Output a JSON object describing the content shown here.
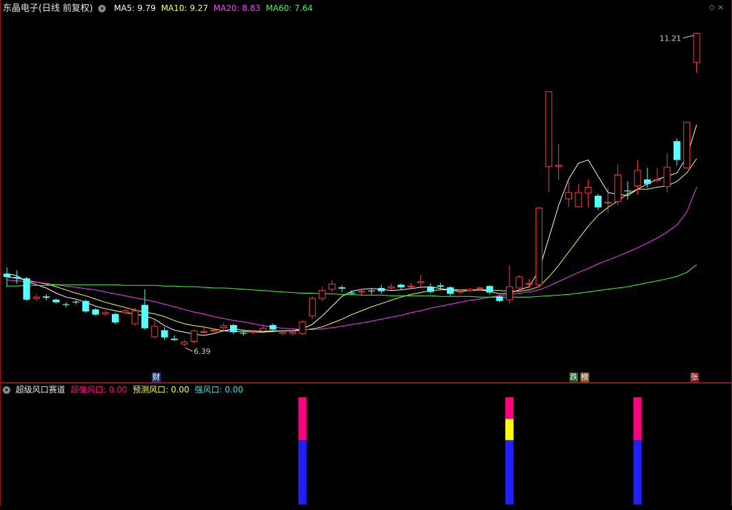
{
  "main_header": {
    "title": "东晶电子(日线 前复权)",
    "ma5_label": "MA5:",
    "ma5_value": "9.79",
    "ma10_label": "MA10:",
    "ma10_value": "9.27",
    "ma20_label": "MA20:",
    "ma20_value": "8.83",
    "ma60_label": "MA60:",
    "ma60_value": "7.64"
  },
  "sub_header": {
    "title": "超级风口赛道",
    "s1_label": "超强风口:",
    "s1_value": "0.00",
    "s2_label": "预测风口:",
    "s2_value": "0.00",
    "s3_label": "强风口:",
    "s3_value": "0.00"
  },
  "tags": {
    "cai": "财",
    "die": "跌",
    "bang": "榜",
    "zhang": "张"
  },
  "annotations": {
    "high_label": "11.21",
    "low_label": "6.39"
  },
  "colors": {
    "up": "#ff3c3c",
    "down": "#54ffff",
    "ma5": "#ffffff",
    "ma10": "#ffff3c",
    "ma20": "#ff3cff",
    "ma60": "#3cff3c",
    "bar_pink": "#ff0080",
    "bar_blue": "#2020ff",
    "bar_yellow": "#ffff00",
    "border": "#8b1a1a"
  },
  "chart_data": [
    {
      "type": "candlestick",
      "title": "东晶电子(日线 前复权)",
      "ylim": [
        6.0,
        11.5
      ],
      "candles": [
        [
          7.5,
          7.45,
          7.6,
          7.3
        ],
        [
          7.45,
          7.43,
          7.55,
          7.35
        ],
        [
          7.43,
          7.1,
          7.45,
          7.08
        ],
        [
          7.12,
          7.14,
          7.18,
          7.08
        ],
        [
          7.15,
          7.13,
          7.18,
          7.09
        ],
        [
          7.1,
          7.06,
          7.12,
          7.04
        ],
        [
          7.03,
          7.02,
          7.06,
          6.98
        ],
        [
          7.07,
          7.06,
          7.09,
          7.03
        ],
        [
          7.08,
          6.92,
          7.1,
          6.9
        ],
        [
          6.95,
          6.87,
          6.97,
          6.85
        ],
        [
          6.88,
          6.9,
          6.93,
          6.85
        ],
        [
          6.88,
          6.75,
          6.9,
          6.72
        ],
        [
          6.9,
          6.93,
          6.96,
          6.88
        ],
        [
          6.73,
          6.93,
          6.97,
          6.7
        ],
        [
          7.02,
          6.66,
          7.26,
          6.64
        ],
        [
          6.53,
          6.69,
          6.78,
          6.5
        ],
        [
          6.63,
          6.52,
          6.68,
          6.48
        ],
        [
          6.5,
          6.48,
          6.55,
          6.46
        ],
        [
          6.42,
          6.45,
          6.48,
          6.39
        ],
        [
          6.46,
          6.62,
          6.64,
          6.43
        ],
        [
          6.6,
          6.61,
          6.7,
          6.58
        ],
        [
          6.63,
          6.63,
          6.66,
          6.6
        ],
        [
          6.67,
          6.7,
          6.74,
          6.63
        ],
        [
          6.71,
          6.6,
          6.73,
          6.57
        ],
        [
          6.59,
          6.58,
          6.62,
          6.55
        ],
        [
          6.6,
          6.61,
          6.64,
          6.57
        ],
        [
          6.62,
          6.66,
          6.72,
          6.58
        ],
        [
          6.71,
          6.64,
          6.73,
          6.62
        ],
        [
          6.58,
          6.6,
          6.62,
          6.55
        ],
        [
          6.58,
          6.6,
          6.63,
          6.55
        ],
        [
          6.58,
          6.76,
          6.78,
          6.56
        ],
        [
          6.85,
          7.12,
          7.15,
          6.8
        ],
        [
          7.12,
          7.24,
          7.3,
          7.08
        ],
        [
          7.26,
          7.34,
          7.4,
          7.22
        ],
        [
          7.29,
          7.27,
          7.32,
          7.22
        ],
        [
          7.21,
          7.2,
          7.24,
          7.17
        ],
        [
          7.22,
          7.23,
          7.27,
          7.16
        ],
        [
          7.24,
          7.23,
          7.28,
          7.18
        ],
        [
          7.28,
          7.23,
          7.33,
          7.19
        ],
        [
          7.28,
          7.3,
          7.35,
          7.25
        ],
        [
          7.33,
          7.29,
          7.35,
          7.25
        ],
        [
          7.3,
          7.31,
          7.36,
          7.27
        ],
        [
          7.36,
          7.38,
          7.48,
          7.28
        ],
        [
          7.3,
          7.22,
          7.35,
          7.2
        ],
        [
          7.32,
          7.3,
          7.36,
          7.26
        ],
        [
          7.29,
          7.19,
          7.31,
          7.16
        ],
        [
          7.22,
          7.23,
          7.26,
          7.18
        ],
        [
          7.24,
          7.26,
          7.28,
          7.22
        ],
        [
          7.27,
          7.28,
          7.3,
          7.24
        ],
        [
          7.31,
          7.21,
          7.32,
          7.18
        ],
        [
          7.15,
          7.08,
          7.17,
          7.06
        ],
        [
          7.1,
          7.3,
          7.63,
          7.04
        ],
        [
          7.28,
          7.45,
          7.48,
          7.25
        ],
        [
          7.35,
          7.35,
          7.42,
          7.28
        ],
        [
          7.33,
          8.51,
          8.52,
          7.29
        ],
        [
          9.15,
          10.3,
          10.3,
          8.75
        ],
        [
          9.15,
          9.17,
          9.49,
          8.94
        ],
        [
          8.65,
          8.75,
          8.92,
          8.53
        ],
        [
          8.53,
          8.75,
          8.88,
          8.52
        ],
        [
          8.74,
          8.83,
          8.95,
          8.52
        ],
        [
          8.7,
          8.52,
          8.73,
          8.48
        ],
        [
          8.6,
          8.6,
          8.82,
          8.44
        ],
        [
          8.61,
          9.02,
          9.18,
          8.55
        ],
        [
          8.78,
          8.77,
          8.92,
          8.64
        ],
        [
          8.85,
          9.09,
          9.25,
          8.72
        ],
        [
          8.95,
          8.88,
          9.13,
          8.82
        ],
        [
          8.95,
          8.95,
          9.12,
          8.91
        ],
        [
          8.84,
          9.14,
          9.35,
          8.75
        ],
        [
          9.54,
          9.25,
          9.58,
          9.16
        ],
        [
          9.13,
          9.83,
          9.83,
          9.12
        ],
        [
          10.75,
          11.2,
          11.21,
          10.59
        ]
      ],
      "ma_series": [
        {
          "name": "MA5",
          "color": "#ffffff",
          "values": [
            7.5,
            7.47,
            7.38,
            7.33,
            7.28,
            7.2,
            7.14,
            7.11,
            7.06,
            7.0,
            6.96,
            6.93,
            6.9,
            6.88,
            6.85,
            6.8,
            6.7,
            6.63,
            6.6,
            6.57,
            6.55,
            6.58,
            6.62,
            6.65,
            6.63,
            6.62,
            6.61,
            6.62,
            6.62,
            6.62,
            6.65,
            6.72,
            6.85,
            7.0,
            7.15,
            7.23,
            7.26,
            7.27,
            7.26,
            7.24,
            7.25,
            7.27,
            7.29,
            7.3,
            7.27,
            7.25,
            7.23,
            7.24,
            7.25,
            7.23,
            7.19,
            7.2,
            7.25,
            7.3,
            7.55,
            8.05,
            8.55,
            8.95,
            9.2,
            9.25,
            9.0,
            8.75,
            8.72,
            8.7,
            8.8,
            8.88,
            8.95,
            9.0,
            9.05,
            9.3,
            9.79
          ]
        },
        {
          "name": "MA10",
          "color": "#ffff3c",
          "values": [
            7.45,
            7.43,
            7.4,
            7.37,
            7.34,
            7.3,
            7.25,
            7.2,
            7.16,
            7.11,
            7.06,
            7.02,
            6.98,
            6.94,
            6.91,
            6.88,
            6.84,
            6.78,
            6.73,
            6.7,
            6.68,
            6.65,
            6.62,
            6.61,
            6.61,
            6.6,
            6.6,
            6.61,
            6.62,
            6.62,
            6.63,
            6.65,
            6.68,
            6.74,
            6.8,
            6.87,
            6.93,
            6.99,
            7.04,
            7.09,
            7.14,
            7.18,
            7.21,
            7.24,
            7.25,
            7.25,
            7.25,
            7.25,
            7.25,
            7.25,
            7.24,
            7.23,
            7.23,
            7.25,
            7.3,
            7.45,
            7.63,
            7.83,
            8.03,
            8.23,
            8.4,
            8.52,
            8.62,
            8.73,
            8.8,
            8.8,
            8.83,
            8.85,
            8.92,
            9.05,
            9.27
          ]
        },
        {
          "name": "MA20",
          "color": "#ff3cff",
          "values": [
            7.4,
            7.39,
            7.38,
            7.37,
            7.35,
            7.33,
            7.31,
            7.29,
            7.27,
            7.25,
            7.22,
            7.19,
            7.16,
            7.13,
            7.1,
            7.07,
            7.03,
            6.99,
            6.95,
            6.91,
            6.88,
            6.84,
            6.81,
            6.78,
            6.76,
            6.73,
            6.7,
            6.68,
            6.66,
            6.65,
            6.64,
            6.64,
            6.65,
            6.67,
            6.69,
            6.72,
            6.74,
            6.77,
            6.8,
            6.83,
            6.86,
            6.9,
            6.93,
            6.97,
            7.0,
            7.03,
            7.06,
            7.09,
            7.11,
            7.14,
            7.16,
            7.18,
            7.2,
            7.22,
            7.25,
            7.31,
            7.38,
            7.45,
            7.52,
            7.58,
            7.65,
            7.71,
            7.77,
            7.83,
            7.9,
            7.97,
            8.05,
            8.14,
            8.25,
            8.45,
            8.83
          ]
        },
        {
          "name": "MA60",
          "color": "#3cff3c",
          "values": [
            7.31,
            7.31,
            7.32,
            7.32,
            7.32,
            7.33,
            7.33,
            7.33,
            7.33,
            7.33,
            7.33,
            7.33,
            7.32,
            7.32,
            7.32,
            7.32,
            7.31,
            7.31,
            7.3,
            7.3,
            7.29,
            7.28,
            7.28,
            7.27,
            7.26,
            7.25,
            7.24,
            7.23,
            7.22,
            7.21,
            7.2,
            7.2,
            7.19,
            7.19,
            7.18,
            7.18,
            7.17,
            7.17,
            7.17,
            7.16,
            7.16,
            7.16,
            7.16,
            7.16,
            7.15,
            7.15,
            7.15,
            7.15,
            7.14,
            7.14,
            7.14,
            7.14,
            7.14,
            7.14,
            7.15,
            7.16,
            7.17,
            7.18,
            7.2,
            7.22,
            7.24,
            7.26,
            7.28,
            7.3,
            7.33,
            7.36,
            7.39,
            7.42,
            7.46,
            7.52,
            7.64
          ]
        }
      ]
    },
    {
      "type": "bar",
      "title": "超级风口赛道",
      "ylim": [
        0,
        1
      ],
      "signals": [
        {
          "candle_index": 30,
          "segments": [
            {
              "color": "#2020ff",
              "value": 0.6
            },
            {
              "color": "#ff0080",
              "value": 0.4
            }
          ]
        },
        {
          "candle_index": 51,
          "segments": [
            {
              "color": "#2020ff",
              "value": 0.6
            },
            {
              "color": "#ffff00",
              "value": 0.2
            },
            {
              "color": "#ff0080",
              "value": 0.2
            }
          ]
        },
        {
          "candle_index": 64,
          "segments": [
            {
              "color": "#2020ff",
              "value": 0.6
            },
            {
              "color": "#ff0080",
              "value": 0.4
            }
          ]
        }
      ]
    }
  ]
}
